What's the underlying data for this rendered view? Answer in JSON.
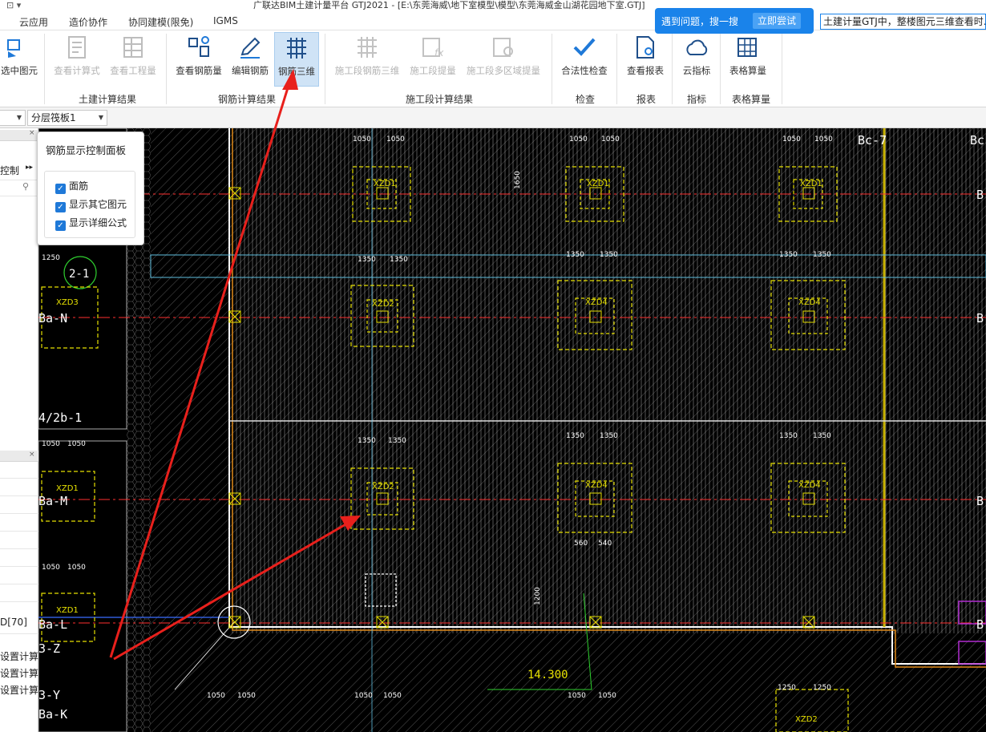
{
  "window": {
    "title": "广联达BIM土建计量平台 GTJ2021 - [E:\\东莞海威\\地下室模型\\模型\\东莞海威金山湖花园地下室.GTJ]"
  },
  "menu": {
    "items": [
      "云应用",
      "造价协作",
      "协同建模(限免)",
      "IGMS"
    ]
  },
  "ribbon": {
    "select_label": "选中图元",
    "civil": {
      "formula": "查看计算式",
      "quantity": "查看工程量",
      "group": "土建计算结果"
    },
    "rebar": {
      "view_qty": "查看钢筋量",
      "edit": "编辑钢筋",
      "rebar3d": "钢筋三维",
      "group": "钢筋计算结果"
    },
    "stage": {
      "rebar3d": "施工段钢筋三维",
      "extract": "施工段提量",
      "multi": "施工段多区域提量",
      "group": "施工段计算结果"
    },
    "check": {
      "legal": "合法性检查",
      "group": "检查"
    },
    "report": {
      "view": "查看报表",
      "group": "报表"
    },
    "index": {
      "cloud": "云指标",
      "group": "指标"
    },
    "table": {
      "calc": "表格算量",
      "group": "表格算量"
    }
  },
  "toolbar": {
    "layer": "分层筏板1"
  },
  "leftpanel": {
    "ctrl": "控制",
    "tag70": "D[70]",
    "items": [
      "设置计算",
      "设置计算",
      "设置计算"
    ]
  },
  "control_panel": {
    "title": "钢筋显示控制面板",
    "options": [
      {
        "label": "面筋",
        "checked": true
      },
      {
        "label": "显示其它图元",
        "checked": true
      },
      {
        "label": "显示详细公式",
        "checked": true
      }
    ]
  },
  "notice": {
    "text": "遇到问题，搜一搜",
    "button": "立即尝试"
  },
  "search": {
    "value": "土建计量GTJ中，整楼图元三维查看时..."
  },
  "cad": {
    "axis_labels": {
      "bc7": "Bc-7",
      "bc_right": "Bc",
      "ba_n": "Ba-N",
      "ba_m": "Ba-M",
      "ba_l": "Ba-L",
      "ba_k": "Ba-K",
      "g4_2b1": "4/2b-1",
      "g3z": "3-Z",
      "g3y": "3-Y",
      "b1": "B",
      "b2": "B",
      "b3": "B",
      "b4": "B"
    },
    "caps": {
      "xzd1": "XZD1",
      "xzd2": "XZD2",
      "xzd3": "XZD3",
      "xzd4": "XZD4"
    },
    "dims": {
      "d1050": "1050",
      "d1350": "1350",
      "d1250": "1250",
      "d1650": "1650",
      "d540": "540",
      "d560": "560",
      "d1200": "1200"
    },
    "elevation": "14.300",
    "bubble": "2-1"
  },
  "colors": {
    "accent": "#1a83ea",
    "arrow": "#e8201c",
    "cad_yellow": "#e6e000",
    "cad_green": "#2fd02f",
    "cad_cyan": "#5fbfe0",
    "cad_red": "#ff3030",
    "cad_orange": "#e08a1a"
  }
}
